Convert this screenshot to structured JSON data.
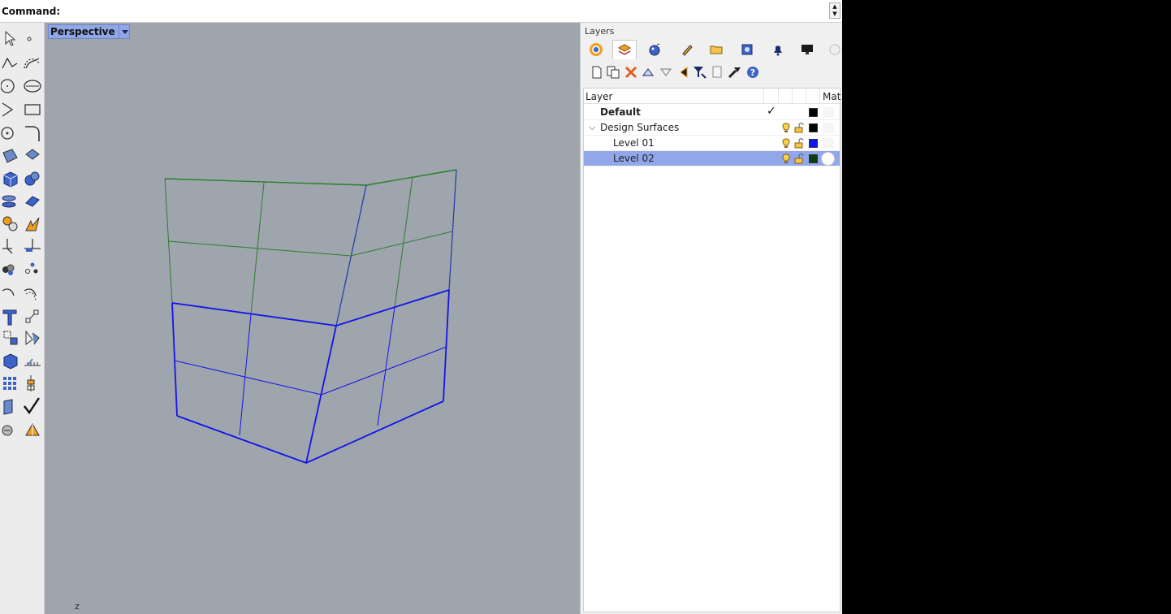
{
  "command": {
    "label": "Command:",
    "value": ""
  },
  "viewport": {
    "title": "Perspective",
    "axis_label": "z"
  },
  "panel": {
    "title": "Layers",
    "tabs": [
      {
        "name": "color-wheel-icon"
      },
      {
        "name": "layers-icon",
        "active": true
      },
      {
        "name": "render-sphere-icon"
      },
      {
        "name": "pen-brush-icon"
      },
      {
        "name": "folder-icon"
      },
      {
        "name": "named-view-icon"
      },
      {
        "name": "notification-bell-icon"
      },
      {
        "name": "display-monitor-icon"
      },
      {
        "name": "misc-tab-icon"
      }
    ],
    "tools": [
      "new-layer-icon",
      "new-sublayer-icon",
      "delete-icon",
      "move-up-icon",
      "move-down-icon",
      "move-left-icon",
      "filter-icon",
      "copy-icon",
      "tools-icon",
      "help-icon"
    ],
    "columns": {
      "layer": "Layer",
      "material": "Mat"
    },
    "layers": [
      {
        "name": "Default",
        "bold": true,
        "current": true,
        "color": "#000000",
        "indent": 0
      },
      {
        "name": "Design Surfaces",
        "expanded": true,
        "color": "#000000",
        "indent": 0,
        "bulb": true,
        "lock": true
      },
      {
        "name": "Level 01",
        "color": "#0a18f0",
        "indent": 1,
        "bulb": true,
        "lock": true
      },
      {
        "name": "Level 02",
        "color": "#0f3d12",
        "indent": 1,
        "bulb": true,
        "lock": true,
        "selected": true
      }
    ]
  },
  "colors": {
    "viewport_bg": "#9ea5ad",
    "level01_wire": "#1414e6",
    "level02_wire": "#2e7d2e",
    "selection": "#92a6ea"
  }
}
